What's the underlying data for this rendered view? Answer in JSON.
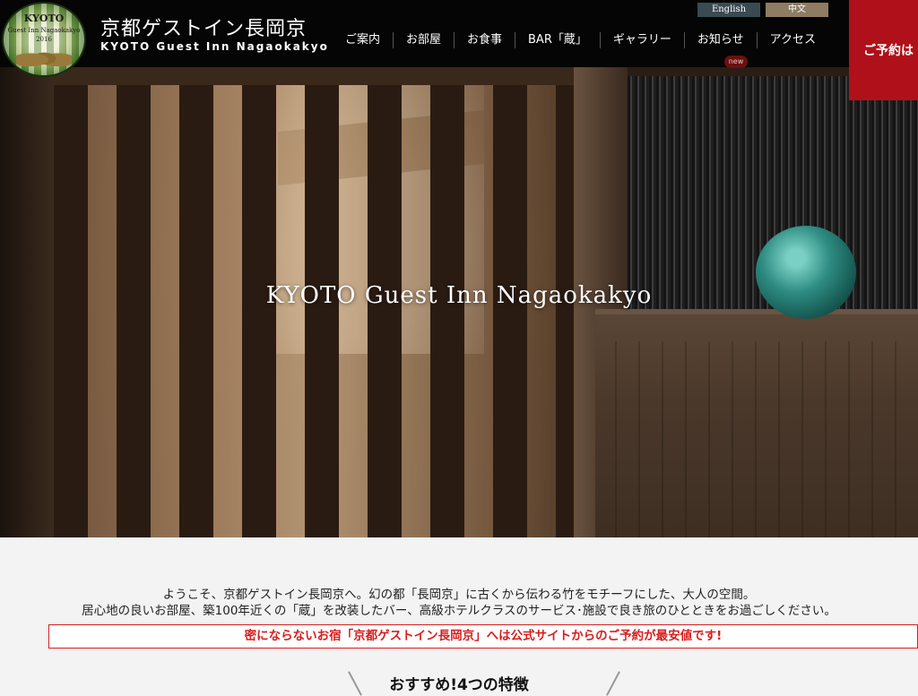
{
  "header": {
    "logo": {
      "line1": "KYOTO",
      "line2": "Guest Inn Nagaokakyo",
      "line3": "2016"
    },
    "title": "京都ゲストイン長岡京",
    "subtitle": "KYOTO Guest Inn Nagaokakyo",
    "languages": {
      "english": "English",
      "chinese": "中文"
    },
    "nav": [
      {
        "label": "ご案内"
      },
      {
        "label": "お部屋"
      },
      {
        "label": "お食事"
      },
      {
        "label": "BAR「蔵」"
      },
      {
        "label": "ギャラリー"
      },
      {
        "label": "お知らせ"
      },
      {
        "label": "アクセス"
      }
    ],
    "new_badge": "new",
    "reserve_label": "ご予約は"
  },
  "hero": {
    "title": "KYOTO Guest Inn Nagaokakyo"
  },
  "intro": {
    "line1": "ようこそ、京都ゲストイン長岡京へ。幻の都「長岡京」に古くから伝わる竹をモチーフにした、大人の空間。",
    "line2": "居心地の良いお部屋、築100年近くの「蔵」を改装したバー、高級ホテルクラスのサービス･施設で良き旅のひとときをお過ごしください。",
    "notice": "密にならないお宿「京都ゲストイン長岡京」へは公式サイトからのご予約が最安値です!",
    "features_title": "おすすめ!4つの特徴"
  },
  "colors": {
    "header_bg": "#050505",
    "reserve_red": "#b0101a",
    "notice_red": "#d81e1e",
    "english_btn": "#3a4a52",
    "chinese_btn": "#8e7c63"
  }
}
